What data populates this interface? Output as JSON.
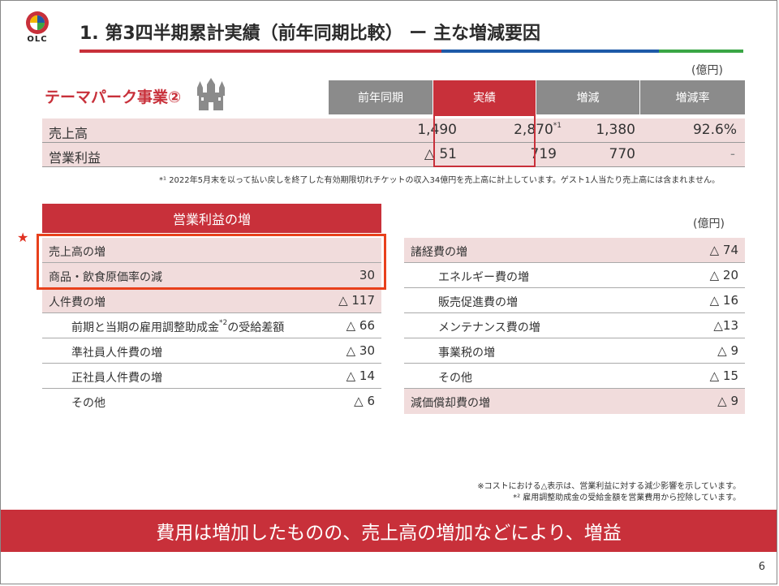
{
  "header": {
    "logo_text": "OLC",
    "title": "1. 第3四半期累計実績（前年同期比較） ー 主な増減要因"
  },
  "unit_label": "(億円)",
  "segment_title": "テーマパーク事業②",
  "summary": {
    "columns": [
      "前年同期",
      "実績",
      "増減",
      "増減率"
    ],
    "rows": [
      {
        "label": "売上高",
        "prev": "1,490",
        "actual": "2,870",
        "actual_mark": "*1",
        "diff": "1,380",
        "rate": "92.6%"
      },
      {
        "label": "営業利益",
        "prev": "△ 51",
        "actual": "719",
        "actual_mark": "",
        "diff": "770",
        "rate": "-"
      }
    ],
    "footnote": "*¹ 2022年5月末を以って払い戻しを終了した有効期限切れチケットの収入34億円を売上高に計上しています。ゲスト1人当たり売上高には含まれません。"
  },
  "increase_table": {
    "header": "営業利益の増",
    "star": "★",
    "rows": [
      {
        "label": "売上高の増",
        "value": "",
        "indent": false,
        "shade": true
      },
      {
        "label": "商品・飲食原価率の減",
        "value": "30",
        "indent": false,
        "shade": true
      },
      {
        "label": "人件費の増",
        "value": "△ 117",
        "indent": false,
        "shade": true
      },
      {
        "label": "前期と当期の雇用調整助成金*2の受給差額",
        "value": "△ 66",
        "indent": true,
        "shade": false
      },
      {
        "label": "準社員人件費の増",
        "value": "△ 30",
        "indent": true,
        "shade": false
      },
      {
        "label": "正社員人件費の増",
        "value": "△ 14",
        "indent": true,
        "shade": false
      },
      {
        "label": "その他",
        "value": "△ 6",
        "indent": true,
        "shade": false
      }
    ]
  },
  "expense_table": {
    "unit_label": "(億円)",
    "rows": [
      {
        "label": "諸経費の増",
        "value": "△ 74",
        "indent": false,
        "shade": true
      },
      {
        "label": "エネルギー費の増",
        "value": "△ 20",
        "indent": true,
        "shade": false
      },
      {
        "label": "販売促進費の増",
        "value": "△ 16",
        "indent": true,
        "shade": false
      },
      {
        "label": "メンテナンス費の増",
        "value": "△13",
        "indent": true,
        "shade": false
      },
      {
        "label": "事業税の増",
        "value": "△ 9",
        "indent": true,
        "shade": false
      },
      {
        "label": "その他",
        "value": "△ 15",
        "indent": true,
        "shade": false
      },
      {
        "label": "減価償却費の増",
        "value": "△ 9",
        "indent": false,
        "shade": true
      }
    ]
  },
  "footnotes": [
    "※コストにおける△表示は、営業利益に対する減少影響を示しています。",
    "*² 雇用調整助成金の受給金額を営業費用から控除しています。"
  ],
  "banner": "費用は増加したものの、売上高の増加などにより、増益",
  "page_number": "6",
  "colors": {
    "accent_red": "#c8303a",
    "header_gray": "#8b8b8b",
    "row_pink": "#f1dcdc",
    "rule_blue": "#1e5aa8",
    "rule_green": "#3aa645"
  }
}
